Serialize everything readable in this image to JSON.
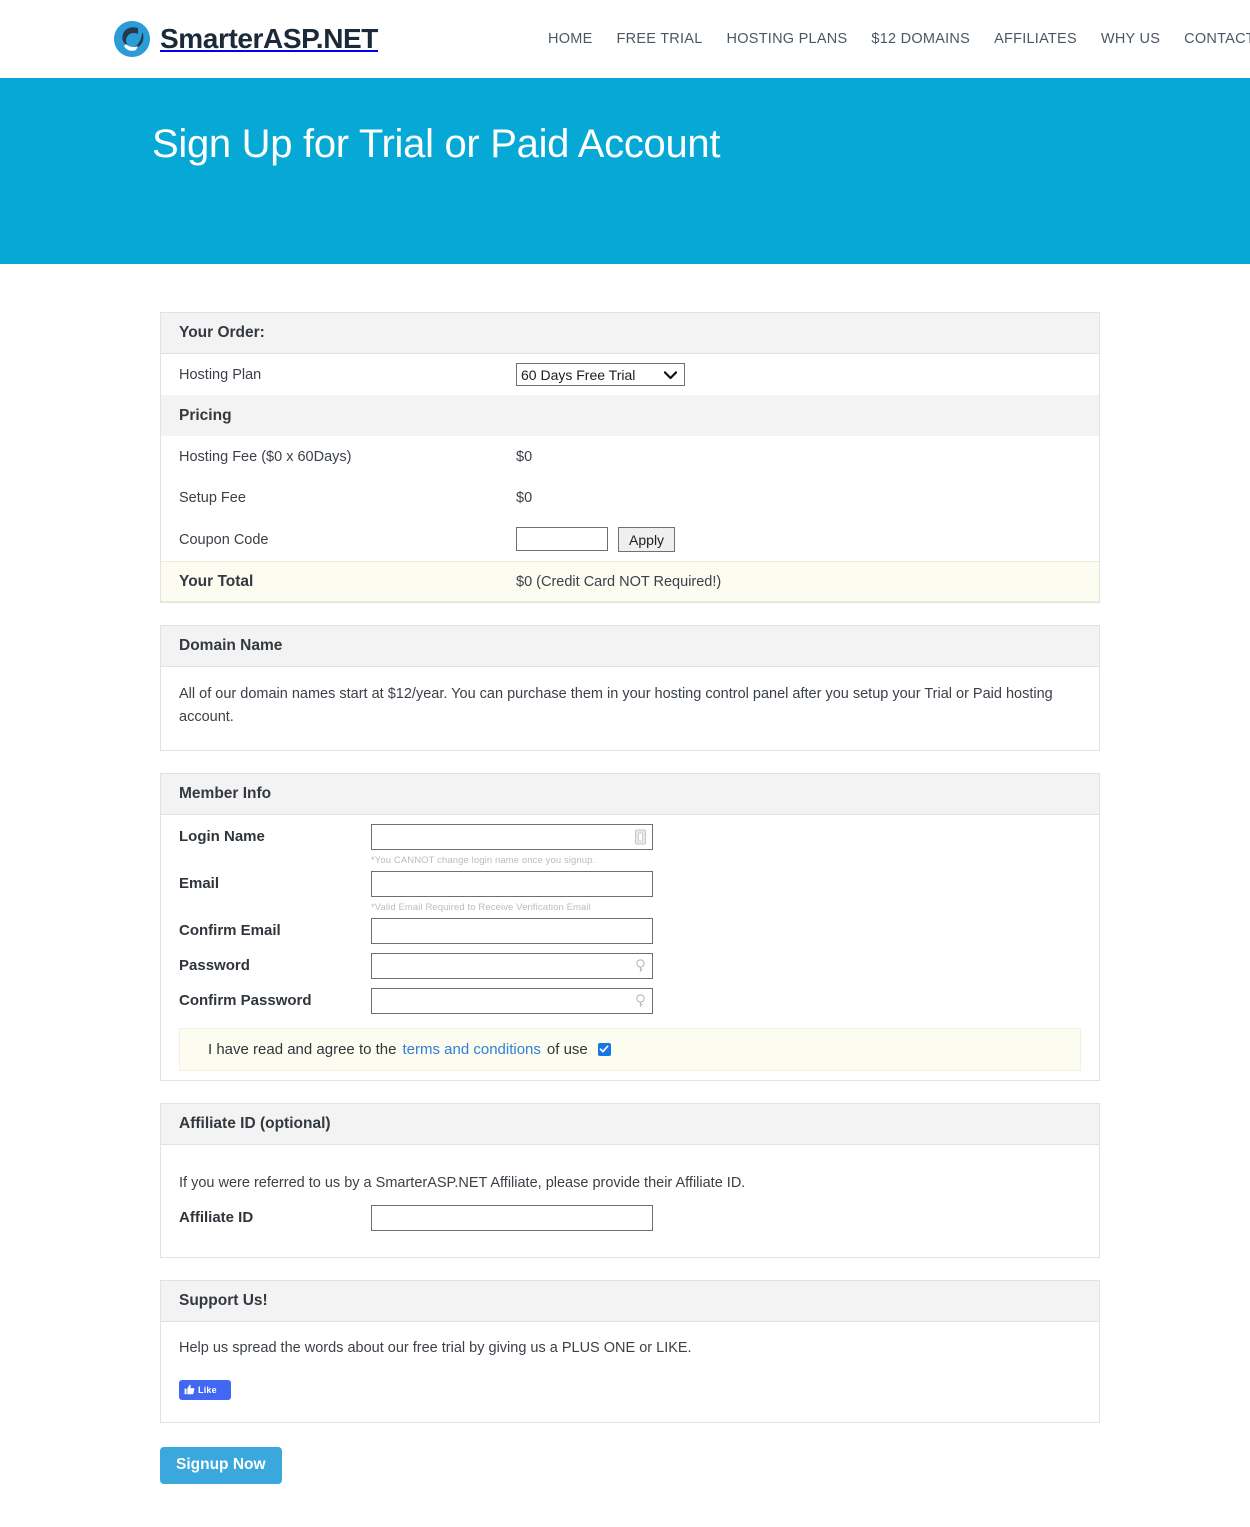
{
  "header": {
    "brand_primary": "Smarter",
    "brand_secondary": "ASP.NET",
    "nav": [
      {
        "label": "HOME"
      },
      {
        "label": "FREE TRIAL"
      },
      {
        "label": "HOSTING PLANS"
      },
      {
        "label": "$12 DOMAINS"
      },
      {
        "label": "AFFILIATES"
      },
      {
        "label": "WHY US"
      },
      {
        "label": "CONTACT US"
      }
    ]
  },
  "hero": {
    "title": "Sign Up for Trial or Paid Account",
    "background_color": "#06a9d6"
  },
  "order": {
    "section_title": "Your Order:",
    "plan_label": "Hosting Plan",
    "plan_selected": "60 Days Free Trial",
    "plan_options": [
      "60 Days Free Trial"
    ]
  },
  "pricing": {
    "section_title": "Pricing",
    "rows": [
      {
        "label": "Hosting Fee ($0 x 60Days)",
        "value": "$0"
      },
      {
        "label": "Setup Fee",
        "value": "$0"
      }
    ],
    "coupon_label": "Coupon Code",
    "coupon_value": "",
    "coupon_placeholder": "",
    "apply_label": "Apply",
    "total_label": "Your Total",
    "total_value": "$0 (Credit Card NOT Required!)",
    "total_background": "#fcfcf0"
  },
  "domain": {
    "section_title": "Domain Name",
    "body": "All of our domain names start at $12/year. You can purchase them in your hosting control panel after you setup your Trial or Paid hosting account."
  },
  "member": {
    "section_title": "Member Info",
    "fields": [
      {
        "label": "Login Name",
        "value": "",
        "hint": "*You CANNOT change login name once you signup.",
        "icon": "contact-card-icon"
      },
      {
        "label": "Email",
        "value": "",
        "hint": "*Valid Email Required to Receive Verification Email",
        "icon": ""
      },
      {
        "label": "Confirm Email",
        "value": "",
        "hint": "",
        "icon": ""
      },
      {
        "label": "Password",
        "value": "",
        "hint": "",
        "icon": "key-icon"
      },
      {
        "label": "Confirm Password",
        "value": "",
        "hint": "",
        "icon": "key-icon"
      }
    ],
    "terms_prefix": "I have read and agree to the",
    "terms_link": "terms and conditions",
    "terms_suffix": "of use",
    "terms_checked": true,
    "terms_link_color": "#2f80d6"
  },
  "affiliate": {
    "section_title": "Affiliate ID (optional)",
    "intro": "If you were referred to us by a SmarterASP.NET Affiliate, please provide their Affiliate ID.",
    "field_label": "Affiliate ID",
    "field_value": ""
  },
  "support": {
    "section_title": "Support Us!",
    "body": "Help us spread the words about our free trial by giving us a PLUS ONE or LIKE.",
    "like_label": "Like",
    "like_color": "#4267f2"
  },
  "submit": {
    "label": "Signup Now",
    "color": "#3aa8dc"
  }
}
